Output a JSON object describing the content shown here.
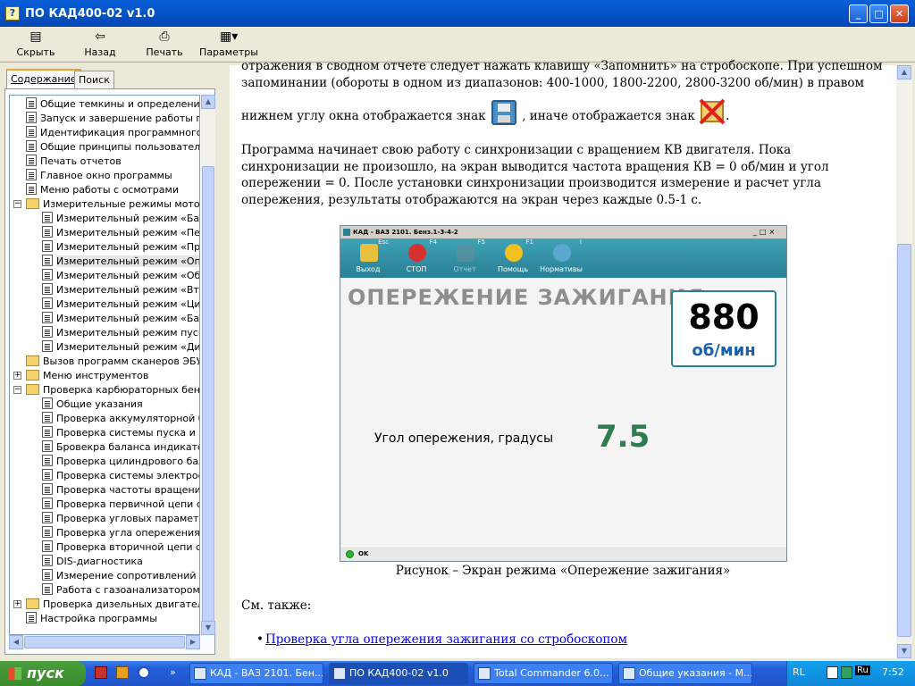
{
  "window": {
    "title": "ПО КАД400-02 v1.0"
  },
  "toolbar": {
    "hide": "Скрыть",
    "back": "Назад",
    "print": "Печать",
    "params": "Параметры"
  },
  "tabs": {
    "contents": "Содержание",
    "search": "Поиск"
  },
  "tree": [
    {
      "label": "Общие темкины и определения",
      "level": 1,
      "type": "page"
    },
    {
      "label": "Запуск и завершение работы программы",
      "level": 1,
      "type": "page"
    },
    {
      "label": "Идентификация программного комплекса",
      "level": 1,
      "type": "page"
    },
    {
      "label": "Общие принципы пользовательского интерфейса",
      "level": 1,
      "type": "page"
    },
    {
      "label": "Печать отчетов",
      "level": 1,
      "type": "page"
    },
    {
      "label": "Главное окно программы",
      "level": 1,
      "type": "page"
    },
    {
      "label": "Меню работы с осмотрами",
      "level": 1,
      "type": "page"
    },
    {
      "label": "Измерительные режимы мотор-тестера",
      "level": 1,
      "type": "folder",
      "exp": "−"
    },
    {
      "label": "Измерительный режим «Батарея»",
      "level": 2,
      "type": "page"
    },
    {
      "label": "Измерительный режим «Первичное напряжение»",
      "level": 2,
      "type": "page"
    },
    {
      "label": "Измерительный режим «Прерыватель»",
      "level": 2,
      "type": "page"
    },
    {
      "label": "Измерительный режим «Опережение зажигания»",
      "level": 2,
      "type": "page",
      "sel": true
    },
    {
      "label": "Измерительный режим «Обороты»",
      "level": 2,
      "type": "page"
    },
    {
      "label": "Измерительный режим «Вторичное напряжение»",
      "level": 2,
      "type": "page"
    },
    {
      "label": "Измерительный режим «Цилиндры»",
      "level": 2,
      "type": "page"
    },
    {
      "label": "Измерительный режим «Баланс»",
      "level": 2,
      "type": "page"
    },
    {
      "label": "Измерительный режим пуска",
      "level": 2,
      "type": "page"
    },
    {
      "label": "Измерительный режим «Диагностика»",
      "level": 2,
      "type": "page"
    },
    {
      "label": "Вызов программ сканеров ЭБУ автомобиля",
      "level": 1,
      "type": "folder"
    },
    {
      "label": "Меню инструментов",
      "level": 1,
      "type": "folder",
      "exp": "+"
    },
    {
      "label": "Проверка карбюраторных бензиновых двигателей",
      "level": 1,
      "type": "folder",
      "exp": "−"
    },
    {
      "label": "Общие указания",
      "level": 2,
      "type": "page"
    },
    {
      "label": "Проверка аккумуляторной батареи",
      "level": 2,
      "type": "page"
    },
    {
      "label": "Проверка системы пуска и контроль",
      "level": 2,
      "type": "page"
    },
    {
      "label": "Бровекра баланса индикатора",
      "level": 2,
      "type": "page"
    },
    {
      "label": "Проверка цилиндрового баланса",
      "level": 2,
      "type": "page"
    },
    {
      "label": "Проверка системы электроснабжения",
      "level": 2,
      "type": "page"
    },
    {
      "label": "Проверка частоты вращения",
      "level": 2,
      "type": "page"
    },
    {
      "label": "Проверка первичной цепи системы",
      "level": 2,
      "type": "page"
    },
    {
      "label": "Проверка угловых параметров",
      "level": 2,
      "type": "page"
    },
    {
      "label": "Проверка угла опережения зажигания",
      "level": 2,
      "type": "page"
    },
    {
      "label": "Проверка вторичной цепи системы",
      "level": 2,
      "type": "page"
    },
    {
      "label": "DIS-диагностика",
      "level": 2,
      "type": "page"
    },
    {
      "label": "Измерение сопротивлений",
      "level": 2,
      "type": "page"
    },
    {
      "label": "Работа с газоанализатором",
      "level": 2,
      "type": "page"
    },
    {
      "label": "Проверка дизельных двигателей",
      "level": 1,
      "type": "folder",
      "exp": "+"
    },
    {
      "label": "Настройка программы",
      "level": 1,
      "type": "page"
    }
  ],
  "content": {
    "p1a": "отражения в сводном отчете следует нажать клавишу «Запомнить» на стробоскопе. При успешном",
    "p1b": "запоминании (обороты в одном из диапазонов: 400-1000, 1800-2200, 2800-3200 об/мин) в правом",
    "p1c": "нижнем углу окна отображается знак",
    "p1d": ", иначе отображается знак",
    "p1e": ".",
    "p2": "Программа начинает свою работу с синхронизации с вращением КВ двигателя. Пока синхронизации не произошло, на экран выводится частота вращения КВ = 0 об/мин и угол опережении = 0. После установки синхронизации производится измерение и расчет угла опережения, результаты отображаются на экран через каждые 0.5-1 с.",
    "caption": "Рисунок – Экран режима «Опережение зажигания»",
    "see_also": "См. также:",
    "link": "Проверка угла опережения зажигания со стробоскопом"
  },
  "screenshot": {
    "title": "КАД - ВАЗ 2101. Бенз.1-3-4-2",
    "buttons": [
      {
        "label": "Выход",
        "key": "Esc",
        "icon": "exit-icon"
      },
      {
        "label": "СТОП",
        "key": "F4",
        "icon": "stop-icon"
      },
      {
        "label": "Отчет",
        "key": "F5",
        "icon": "report-icon"
      },
      {
        "label": "Помощь",
        "key": "F1",
        "icon": "help-icon"
      },
      {
        "label": "Нормативы",
        "key": "I",
        "icon": "info-icon"
      }
    ],
    "heading": "ОПЕРЕЖЕНИЕ ЗАЖИГАНИЯ",
    "rpm_value": "880",
    "rpm_unit": "об/мин",
    "angle_label": "Угол опережения, градусы",
    "angle_value": "7.5",
    "status": "OK"
  },
  "taskbar": {
    "start": "пуск",
    "tasks": [
      "КАД - ВАЗ 2101. Бен...",
      "ПО КАД400-02 v1.0",
      "Total Commander 6.0...",
      "Общие указания - М..."
    ],
    "lang": "RL",
    "lang2": "Ru",
    "time": "7:52"
  },
  "colors": {
    "accent": "#2a7f95",
    "value_green": "#2e7d4f",
    "rpm_blue": "#1a5fa8"
  }
}
